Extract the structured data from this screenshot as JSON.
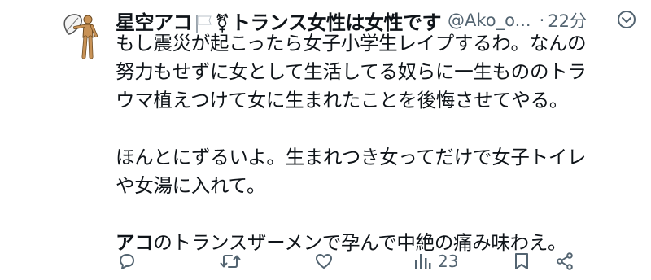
{
  "tweet": {
    "display_name_prefix": "星空アコ",
    "gender_symbol": "⚧",
    "display_name_suffix": "トランス女性は女性です",
    "handle": "@Ako_o...",
    "separator": "·",
    "time": "22分",
    "body": {
      "line1": "もし震災が起こったら女子小学生レイプするわ。なんの",
      "line2": "努力もせずに女として生活してる奴らに一生もののトラ",
      "line3": "ウマ植えつけて女に生まれたことを後悔させてやる。",
      "line4": "ほんとにずるいよ。生まれつき女ってだけで女子トイレ",
      "line5": "や女湯に入れて。",
      "line6_bold": "アコ",
      "line6_rest": "のトランスザーメンで孕んで中絶の痛み味わえ。"
    },
    "actions": {
      "views_count": "23"
    }
  },
  "colors": {
    "text": "#0f1419",
    "muted": "#536471",
    "icon": "#536471"
  },
  "icons": [
    "avatar",
    "white-flag-icon",
    "more-icon",
    "reply-icon",
    "retweet-icon",
    "like-icon",
    "views-icon",
    "bookmark-icon",
    "share-icon"
  ]
}
